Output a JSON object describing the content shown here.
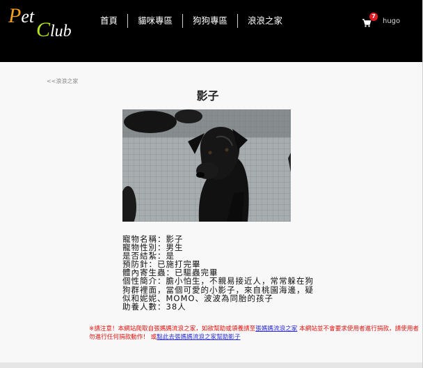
{
  "header": {
    "logo_line1_cap": "P",
    "logo_line1_rest": "et",
    "logo_line2_cap": "C",
    "logo_line2_rest": "lub",
    "nav": [
      "首頁",
      "貓咪專區",
      "狗狗專區",
      "浪浪之家"
    ],
    "cart_count": "7",
    "username": "hugo"
  },
  "page": {
    "back_link": "<<浪浪之家",
    "title": "影子",
    "photo_icon": "black-dog-photo"
  },
  "info": {
    "name": "寵物名稱：影子",
    "gender": "寵物性別：男生",
    "neutered": "是否結紮：是",
    "vaccine": "預防針：已施打完畢",
    "deworm": "體內寄生蟲：已驅蟲完畢",
    "desc_line1": "個性簡介：膽小怕生，不親易接近人，常常躲在狗",
    "desc_line2": "狗群裡面，當個可愛的小影子，來自桃園海邊，疑",
    "desc_line3": "似和妮妮、MOMO、波波為同胎的孩子",
    "sponsors": "助養人數：38人"
  },
  "notice": {
    "part1": "※請注意！本網站爬取自張媽媽流浪之家，如欲幫助或領養請至",
    "link1": "張媽媽流浪之家",
    "part2": " 本網站並不會要求使用者進行捐款，請使用者勿進行任何捐款動作！ 或",
    "link2": "點此去張媽媽流浪之家幫助影子"
  },
  "colors": {
    "header_bg": "#000000",
    "logo_p": "#f0a01e",
    "logo_c": "#b5e61d",
    "badge": "#e01b24",
    "notice": "#e0120e",
    "link": "#2a2ad6"
  }
}
